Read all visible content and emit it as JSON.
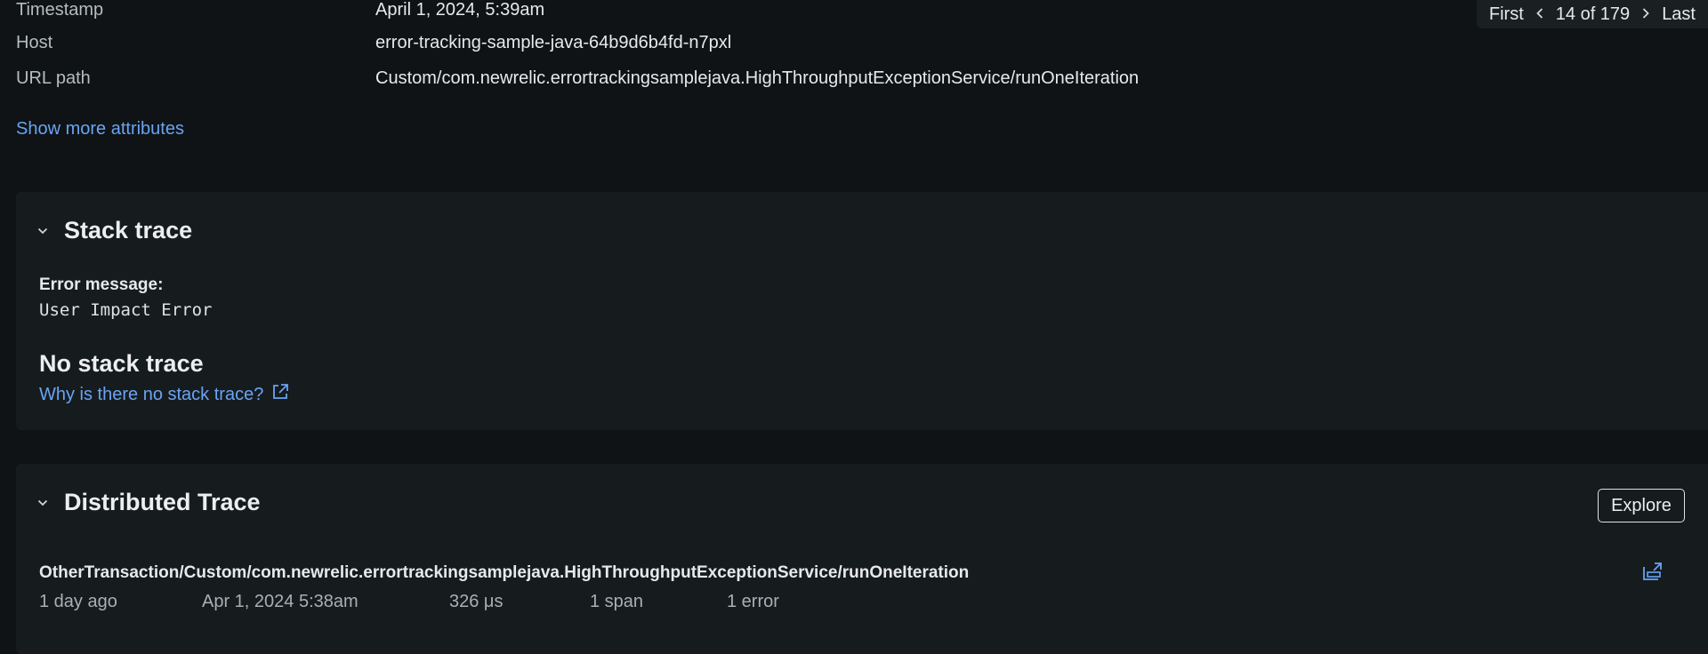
{
  "attributes": [
    {
      "key": "Timestamp",
      "value": "April 1, 2024, 5:39am"
    },
    {
      "key": "Host",
      "value": "error-tracking-sample-java-64b9d6b4fd-n7pxl"
    },
    {
      "key": "URL path",
      "value": "Custom/com.newrelic.errortrackingsamplejava.HighThroughputExceptionService/runOneIteration"
    }
  ],
  "show_more_label": "Show more attributes",
  "pager": {
    "first_label": "First",
    "position_text": "14 of 179",
    "last_label": "Last",
    "prev_icon": "chevron-left-icon",
    "next_icon": "chevron-right-icon"
  },
  "stack_trace": {
    "title": "Stack trace",
    "error_message_label": "Error message:",
    "error_message": "User Impact Error",
    "no_stack_title": "No stack trace",
    "why_link": "Why is there no stack trace?",
    "link_icon": "external-link-icon"
  },
  "distributed_trace": {
    "title": "Distributed Trace",
    "explore_label": "Explore",
    "trace_name": "OtherTransaction/Custom/com.newrelic.errortrackingsamplejava.HighThroughputExceptionService/runOneIteration",
    "relative_time": "1 day ago",
    "date": "Apr 1, 2024 5:38am",
    "duration": "326 μs",
    "spans": "1 span",
    "errors": "1 error",
    "open_icon": "open-trace-icon"
  },
  "colors": {
    "background": "#0f1315",
    "card": "#161b1e",
    "link": "#6aa4f2",
    "text": "#e7e9ea",
    "muted": "#a9afb2"
  }
}
